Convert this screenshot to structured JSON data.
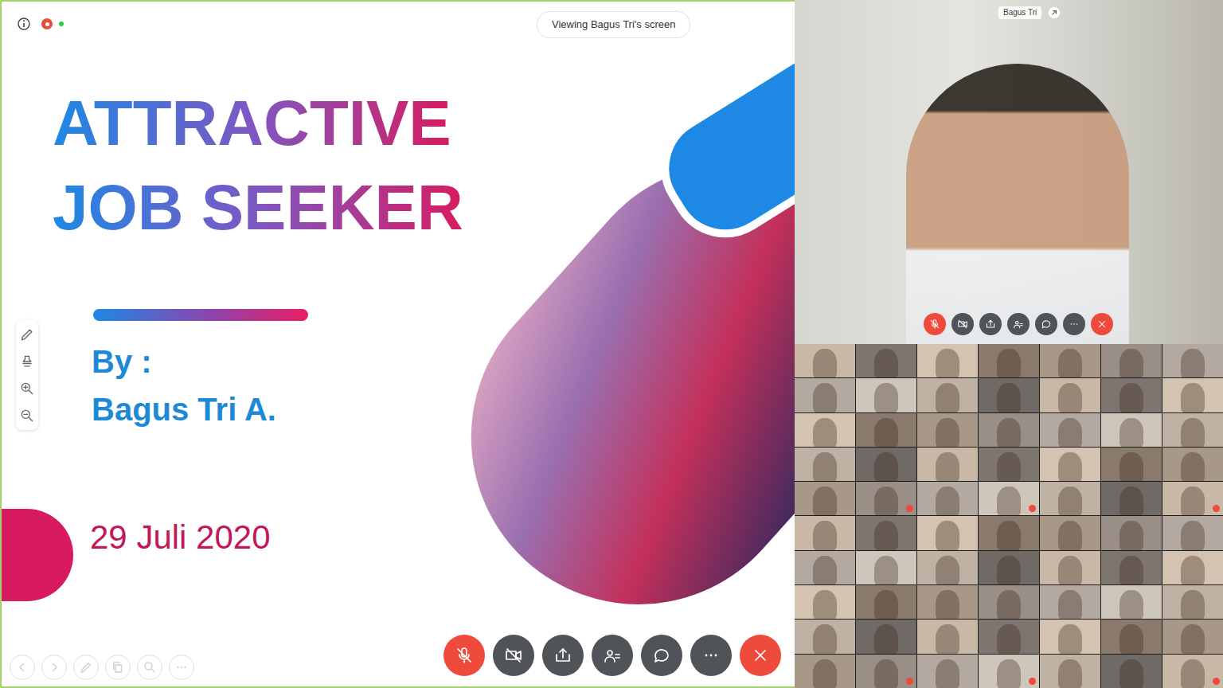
{
  "status": {
    "viewing": "Viewing Bagus Tri's screen",
    "recording": true,
    "connected": true
  },
  "slide": {
    "title": [
      "ATTRACTIVE",
      "JOB SEEKER"
    ],
    "by": "By :",
    "author": "Bagus Tri A.",
    "date": "29 Juli 2020"
  },
  "speaker": {
    "name": "Bagus Tri"
  },
  "controls": [
    {
      "kind": "mic",
      "muted": true,
      "danger": true
    },
    {
      "kind": "camera",
      "muted": true,
      "danger": false
    },
    {
      "kind": "share",
      "muted": false,
      "danger": false
    },
    {
      "kind": "participants",
      "muted": false,
      "danger": false
    },
    {
      "kind": "chat",
      "muted": false,
      "danger": false
    },
    {
      "kind": "more",
      "muted": false,
      "danger": false
    },
    {
      "kind": "leave",
      "muted": false,
      "danger": true
    }
  ],
  "annotation_tools": [
    {
      "kind": "pen"
    },
    {
      "kind": "stamp"
    },
    {
      "kind": "zoom-in"
    },
    {
      "kind": "zoom-out"
    }
  ],
  "slide_nav": [
    {
      "kind": "prev"
    },
    {
      "kind": "next"
    },
    {
      "kind": "pen"
    },
    {
      "kind": "copy"
    },
    {
      "kind": "search"
    },
    {
      "kind": "more"
    }
  ],
  "participants": [
    {
      "muted": false
    },
    {
      "muted": false
    },
    {
      "muted": false
    },
    {
      "muted": false
    },
    {
      "muted": false
    },
    {
      "muted": false
    },
    {
      "muted": false
    },
    {
      "muted": false
    },
    {
      "muted": false
    },
    {
      "muted": false
    },
    {
      "muted": false
    },
    {
      "muted": false
    },
    {
      "muted": false
    },
    {
      "muted": false
    },
    {
      "muted": false
    },
    {
      "muted": false
    },
    {
      "muted": false
    },
    {
      "muted": false
    },
    {
      "muted": false
    },
    {
      "muted": false
    },
    {
      "muted": false
    },
    {
      "muted": false
    },
    {
      "muted": false
    },
    {
      "muted": false
    },
    {
      "muted": false
    },
    {
      "muted": false
    },
    {
      "muted": false
    },
    {
      "muted": false
    },
    {
      "muted": false
    },
    {
      "muted": true
    },
    {
      "muted": false
    },
    {
      "muted": true
    },
    {
      "muted": false
    },
    {
      "muted": false
    },
    {
      "muted": true
    },
    {
      "muted": false
    },
    {
      "muted": false
    },
    {
      "muted": false
    },
    {
      "muted": false
    },
    {
      "muted": false
    },
    {
      "muted": false
    },
    {
      "muted": false
    },
    {
      "muted": false
    },
    {
      "muted": false
    },
    {
      "muted": false
    },
    {
      "muted": false
    },
    {
      "muted": false
    },
    {
      "muted": false
    },
    {
      "muted": false
    },
    {
      "muted": false
    },
    {
      "muted": false
    },
    {
      "muted": false
    },
    {
      "muted": false
    },
    {
      "muted": false
    },
    {
      "muted": false
    },
    {
      "muted": false
    },
    {
      "muted": false
    },
    {
      "muted": false
    },
    {
      "muted": false
    },
    {
      "muted": false
    },
    {
      "muted": false
    },
    {
      "muted": false
    },
    {
      "muted": false
    },
    {
      "muted": false
    },
    {
      "muted": true
    },
    {
      "muted": false
    },
    {
      "muted": true
    },
    {
      "muted": false
    },
    {
      "muted": false
    },
    {
      "muted": true
    }
  ]
}
